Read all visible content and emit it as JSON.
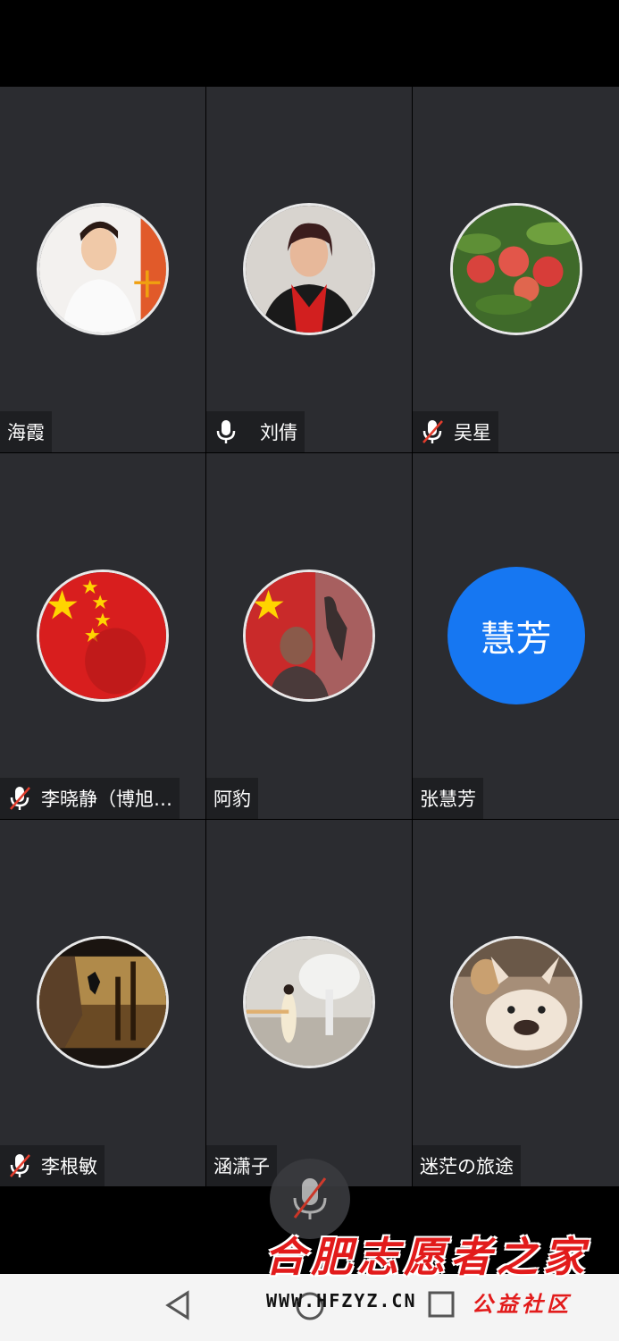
{
  "participants": [
    {
      "name": "海霞",
      "mic": "none",
      "avatar": "photo-woman-white",
      "avatar_text": ""
    },
    {
      "name": "刘倩",
      "mic": "on",
      "avatar": "photo-woman-red-scarf",
      "avatar_text": ""
    },
    {
      "name": "吴星",
      "mic": "muted",
      "avatar": "photo-peaches",
      "avatar_text": ""
    },
    {
      "name": "李晓静（博旭…",
      "mic": "muted",
      "avatar": "photo-china-flag",
      "avatar_text": ""
    },
    {
      "name": "阿豹",
      "mic": "none",
      "avatar": "photo-flag-man",
      "avatar_text": ""
    },
    {
      "name": "张慧芳",
      "mic": "none",
      "avatar": "text-avatar",
      "avatar_text": "慧芳"
    },
    {
      "name": "李根敏",
      "mic": "muted",
      "avatar": "photo-climber",
      "avatar_text": ""
    },
    {
      "name": "涵潇子",
      "mic": "none",
      "avatar": "photo-white-tree",
      "avatar_text": ""
    },
    {
      "name": "迷茫の旅途",
      "mic": "none",
      "avatar": "photo-dogs",
      "avatar_text": ""
    }
  ],
  "watermark": {
    "title": "合肥志愿者之家",
    "url": "WWW.HFZYZ.CN",
    "tag": "公益社区"
  },
  "colors": {
    "tile_bg": "#2b2c30",
    "namebar_bg": "#1e1f22",
    "text_avatar_bg": "#1677f2",
    "watermark_red": "#e21b1b"
  }
}
